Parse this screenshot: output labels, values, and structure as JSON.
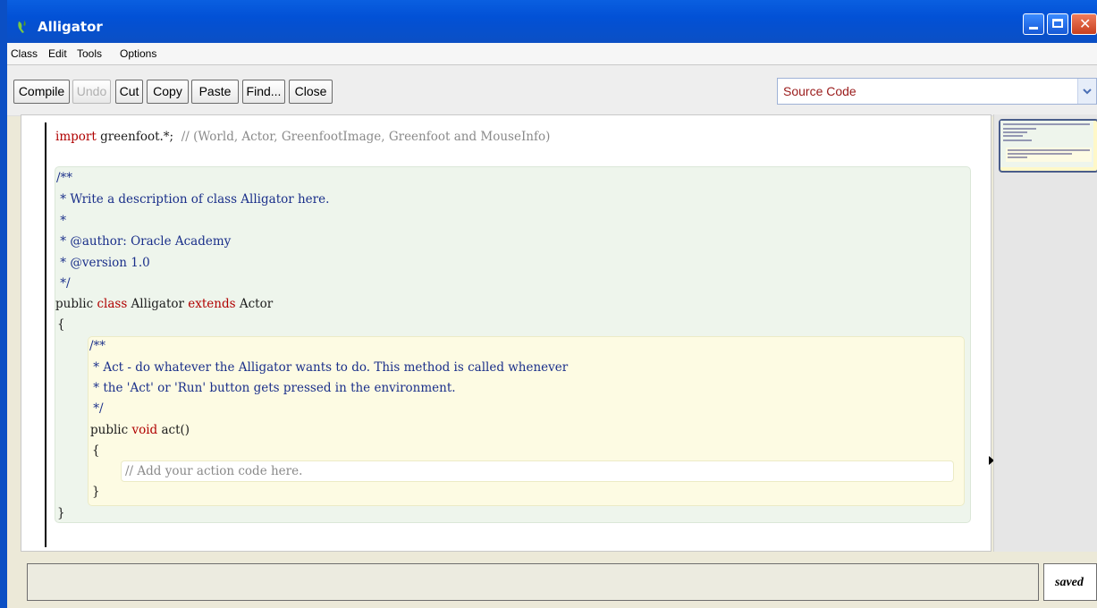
{
  "window": {
    "title": "Alligator"
  },
  "menu": [
    "Class",
    "Edit",
    "Tools",
    "Options"
  ],
  "toolbar": {
    "buttons": [
      "Compile",
      "Undo",
      "Cut",
      "Copy",
      "Paste",
      "Find...",
      "Close"
    ],
    "view_select": "Source Code"
  },
  "code": {
    "line1_kw": "import",
    "line1_pkg": " greenfoot.*;",
    "line1_comment": "  // (World, Actor, GreenfootImage, Greenfoot and MouseInfo)",
    "doc1": "/**",
    "doc2": " * Write a description of class Alligator here.",
    "doc3": " *",
    "doc4": " * @author: Oracle Academy",
    "doc5": " * @version 1.0",
    "doc6": " */",
    "class_public": "public",
    "class_kw": " class",
    "class_name": " Alligator",
    "class_extends": " extends",
    "class_parent": " Actor",
    "open_brace": "{",
    "mdoc1": "/**",
    "mdoc2": " * Act - do whatever the Alligator wants to do. This method is called whenever",
    "mdoc3": " * the 'Act' or 'Run' button gets pressed in the environment.",
    "mdoc4": " */",
    "method_public": "public",
    "method_void": " void",
    "method_name": " act()",
    "method_open": "{",
    "body_comment": "// Add your action code here.",
    "method_close": "}",
    "close_brace": "}"
  },
  "status": {
    "text": "",
    "saved": "saved"
  }
}
